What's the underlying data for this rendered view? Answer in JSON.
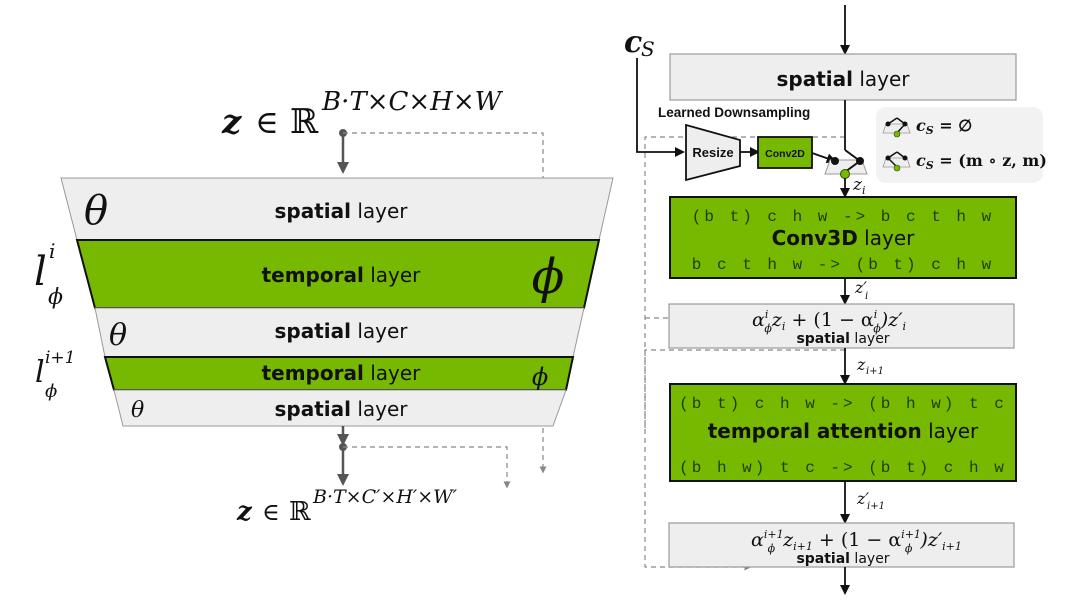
{
  "colors": {
    "green": "#76b900",
    "gray_fill": "#eeeeee",
    "gray_stroke": "#999999",
    "dash": "#888888",
    "arrow_gray": "#555555",
    "legend_bg": "#f2f2f2"
  },
  "left": {
    "input_shape": {
      "var": "z",
      "in": "∈",
      "set": "ℝ",
      "sup": "B·T×C×H×W"
    },
    "output_shape": {
      "var": "z",
      "in": "∈",
      "set": "ℝ",
      "sup": "B·T×C′×H′×W′"
    },
    "layers": [
      {
        "type": "spatial",
        "bold": "spatial",
        "rest": " layer",
        "param": "θ"
      },
      {
        "type": "temporal",
        "bold": "temporal",
        "rest": " layer",
        "param": "ϕ",
        "side_label": {
          "base": "l",
          "sup": "i",
          "sub": "ϕ"
        }
      },
      {
        "type": "spatial",
        "bold": "spatial",
        "rest": " layer",
        "param": "θ"
      },
      {
        "type": "temporal",
        "bold": "temporal",
        "rest": " layer",
        "param": "ϕ",
        "side_label": {
          "base": "l",
          "sup": "i+1",
          "sub": "ϕ"
        }
      },
      {
        "type": "spatial",
        "bold": "spatial",
        "rest": " layer",
        "param": "θ"
      }
    ]
  },
  "right": {
    "cs_label": {
      "base": "c",
      "sub": "S"
    },
    "top_spatial": {
      "bold": "spatial",
      "rest": " layer"
    },
    "downsampling_title": "Learned Downsampling",
    "resize_label": "Resize",
    "conv2d_label": "Conv2D",
    "legend": [
      {
        "icon": "switch-open-icon",
        "text": "c",
        "sub": "S",
        "rhs": " = ∅"
      },
      {
        "icon": "switch-closed-icon",
        "text": "c",
        "sub": "S",
        "rhs": " = (m ∘ z, m)"
      }
    ],
    "zi_label": {
      "base": "z",
      "sub": "i"
    },
    "conv3d": {
      "rearrange_in": "(b t) c h w -> b c t h w",
      "bold": "Conv3D",
      "rest": " layer",
      "rearrange_out": "b c t h w -> (b t) c h w"
    },
    "zi_prime_label": {
      "base": "z′",
      "sub": "i"
    },
    "mix1": {
      "formula": "α",
      "formula_parts": [
        "α",
        "i",
        "ϕ",
        "z",
        "i",
        " + (1 − α",
        "i",
        "ϕ",
        ")z′",
        "i"
      ],
      "bold": "spatial",
      "rest": " layer"
    },
    "zi1_label": {
      "base": "z",
      "sub": "i+1"
    },
    "temporal": {
      "rearrange_in": "(b t) c h w -> (b h w) t c",
      "bold": "temporal attention",
      "rest": " layer",
      "rearrange_out": "(b h w) t c -> (b t) c h w"
    },
    "zi1_prime_label": {
      "base": "z′",
      "sub": "i+1"
    },
    "mix2": {
      "formula_parts": [
        "α",
        "i+1",
        "ϕ",
        "z",
        "i+1",
        " + (1 − α",
        "i+1",
        "ϕ",
        ")z′",
        "i+1"
      ],
      "bold": "spatial",
      "rest": " layer"
    }
  }
}
